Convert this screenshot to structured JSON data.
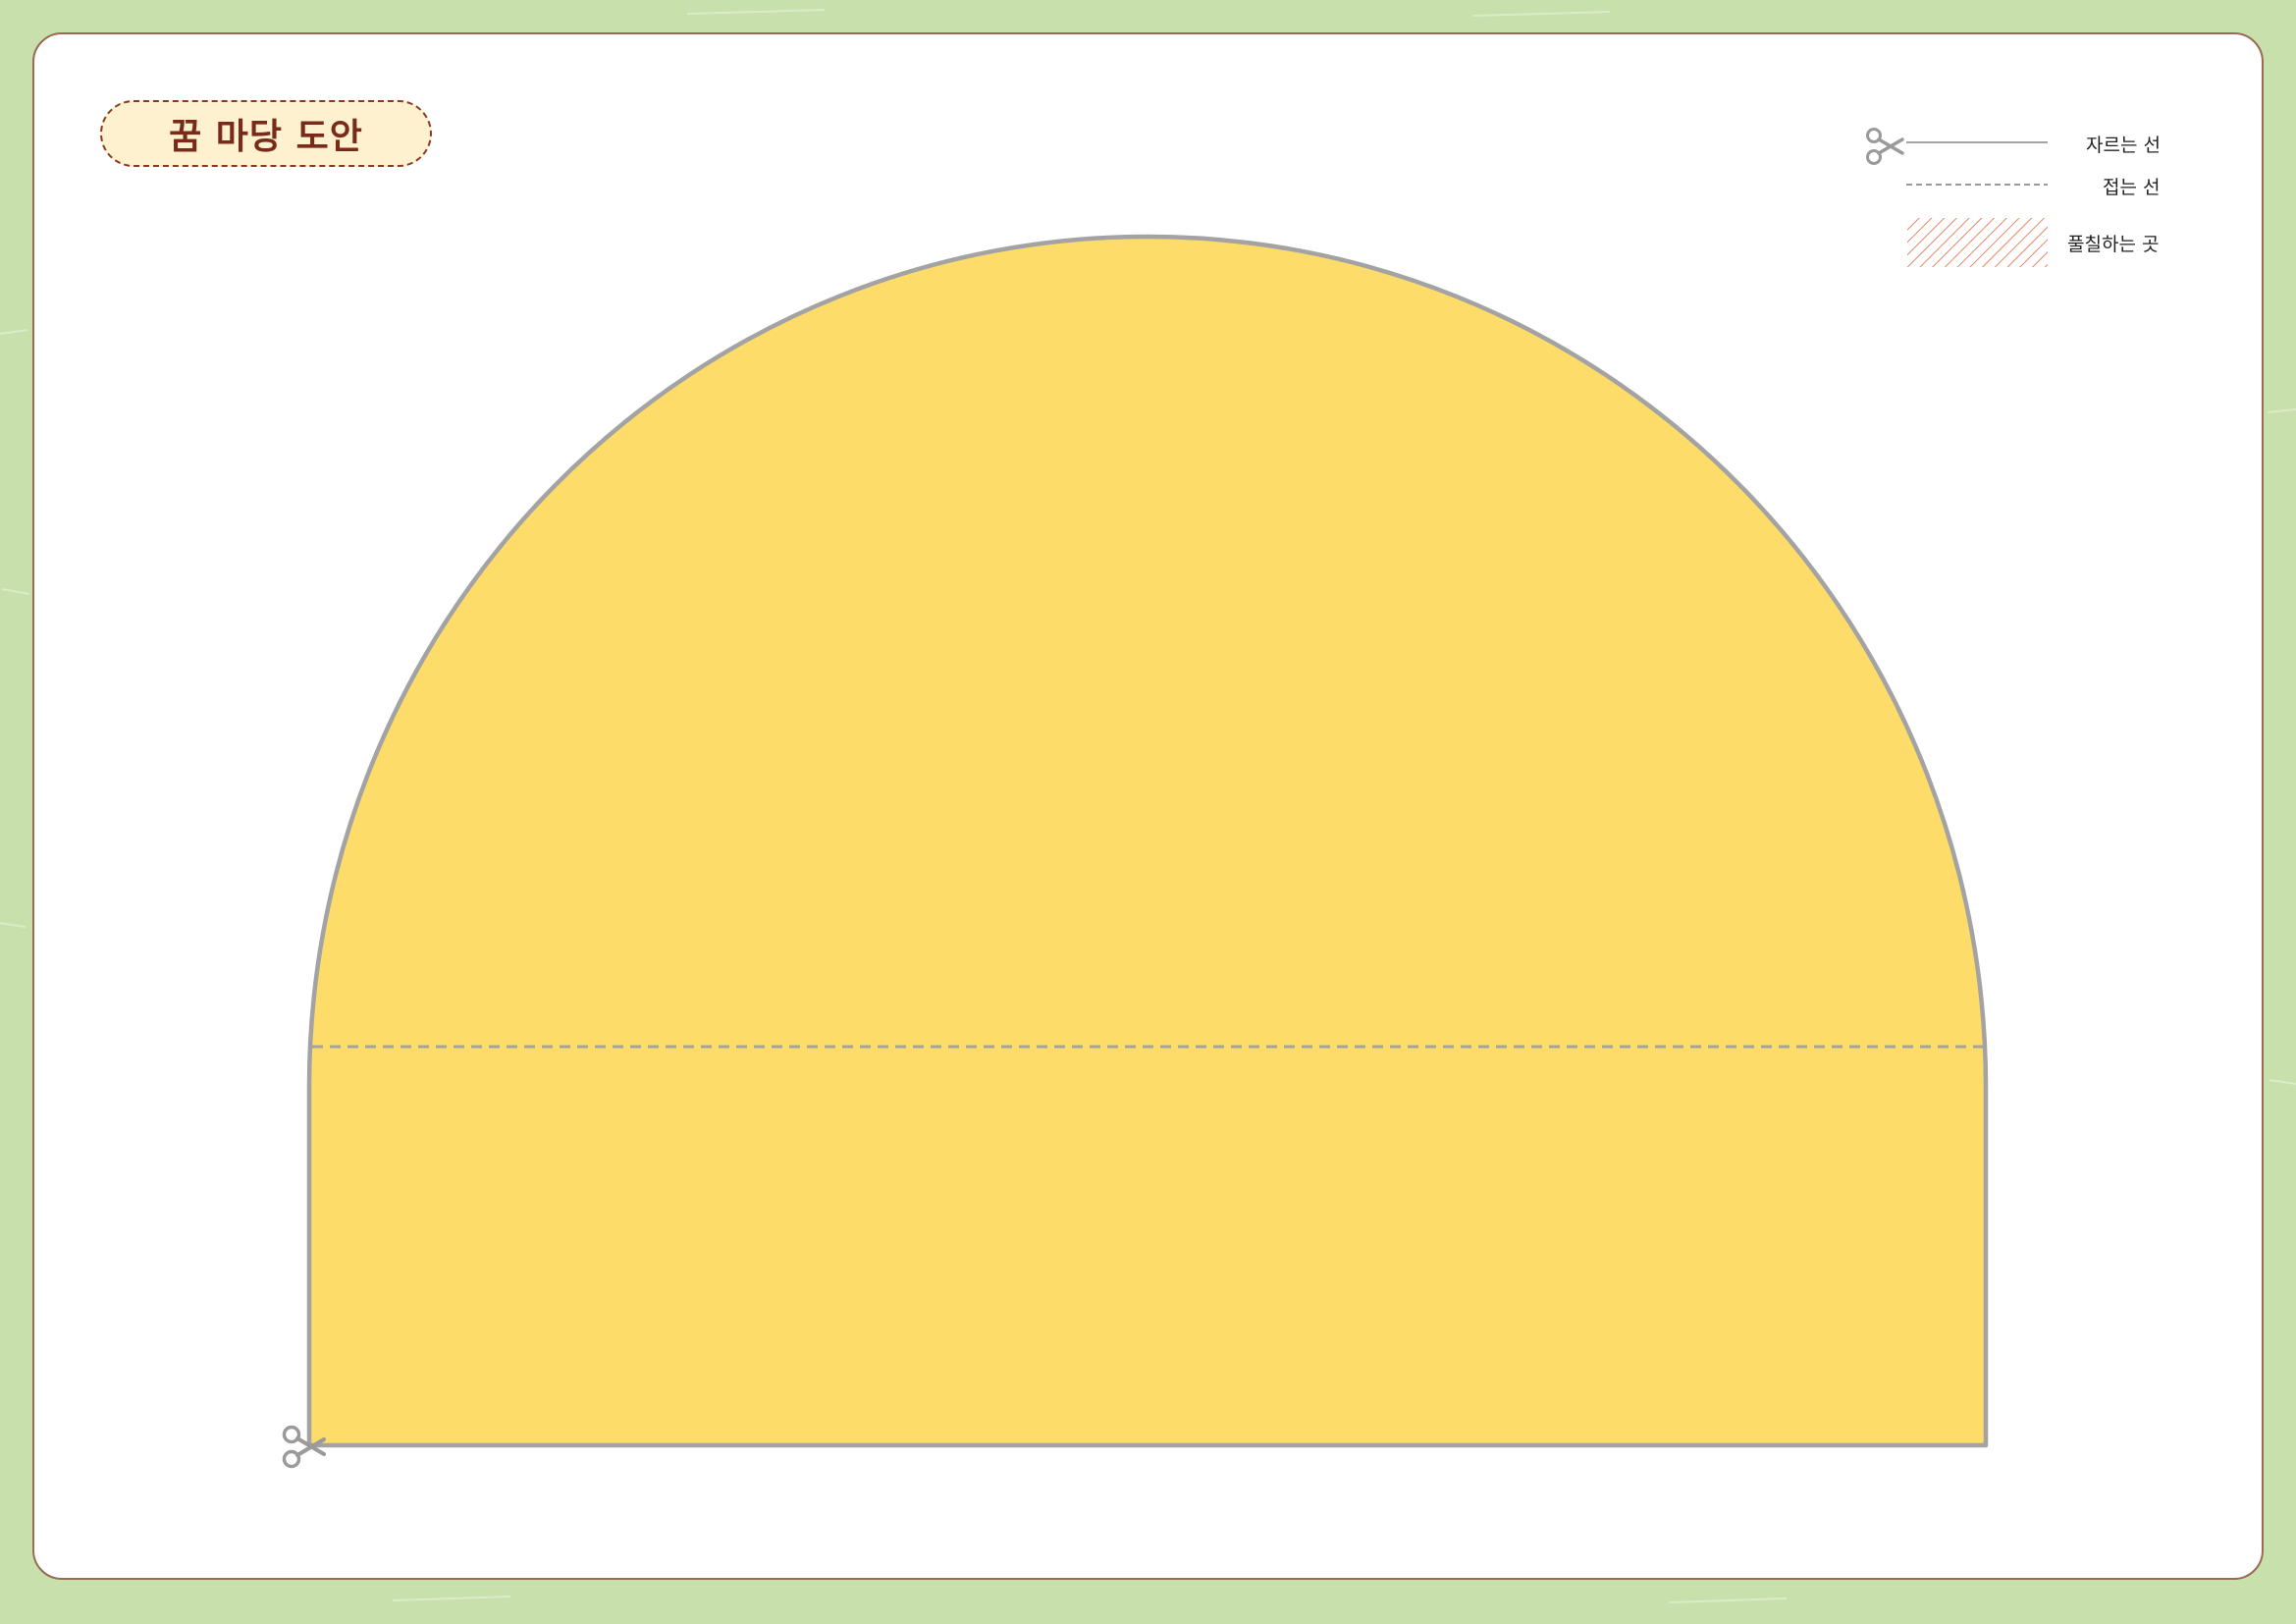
{
  "title": "꿈 마당 도안",
  "legend": {
    "cut_line": "자르는 선",
    "fold_line": "접는 선",
    "glue_area": "풀칠하는 곳"
  },
  "colors": {
    "background": "#c8e0ab",
    "card": "#ffffff",
    "card_border": "#9a6a52",
    "shape_fill": "#fddc6a",
    "outline": "#a3a3a3",
    "title_fill": "#fdf1cf",
    "title_text": "#7a2a18",
    "glue_hatch": "#e8876a"
  },
  "icons": [
    "scissors-icon"
  ]
}
